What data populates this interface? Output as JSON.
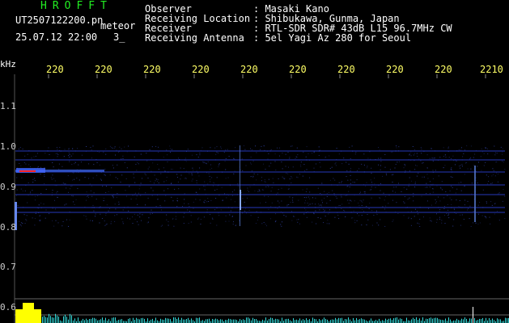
{
  "header": {
    "app_name": "HROFFT",
    "filename": "UT2507122200.pn",
    "meteor_label": "meteor",
    "datetime": "25.07.12 22:00",
    "count": "3_"
  },
  "station_info": [
    {
      "label": "Observer",
      "value": ": Masaki Kano"
    },
    {
      "label": "Receiving Location",
      "value": ": Shibukawa, Gunma, Japan"
    },
    {
      "label": "Receiver",
      "value": ": RTL-SDR SDR# 43dB L15 96.7MHz CW"
    },
    {
      "label": "Receiving Antenna",
      "value": ": 5el Yagi Az 280 for Seoul"
    }
  ],
  "axis": {
    "y_unit": "kHz",
    "y_ticks": [
      "1.1",
      "1.0",
      "0.9",
      "0.8",
      "0.7",
      "0.6"
    ],
    "x_ticks": [
      "220",
      "220",
      "220",
      "220",
      "220",
      "220",
      "220",
      "220",
      "220",
      "2210"
    ]
  },
  "colors": {
    "app_name": "#22ee22",
    "info_value": "#ffffff",
    "tick_x": "#ffff66",
    "background": "#000000",
    "signal_low": "#2233aa",
    "signal_high": "#ff2222",
    "level_bar": "#ffff00",
    "level_noise": "#33dddd"
  }
}
